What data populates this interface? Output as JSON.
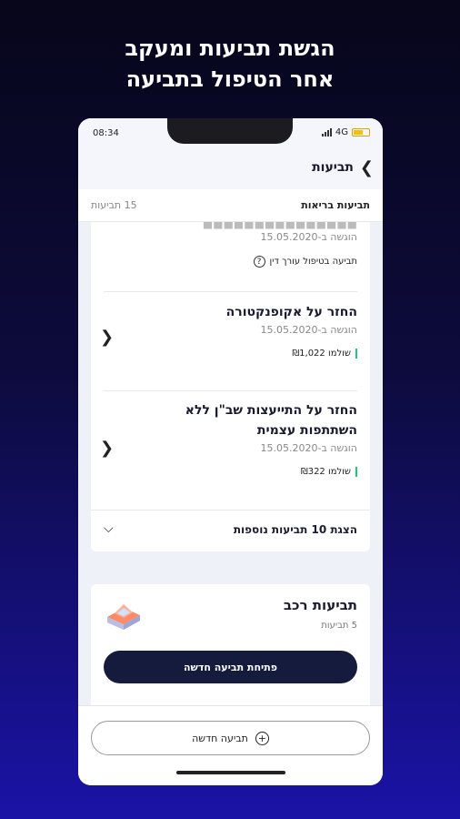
{
  "headline": {
    "line1": "הגשת תביעות ומעקב",
    "line2": "אחר הטיפול בתביעה"
  },
  "status_bar": {
    "time": "08:34",
    "network": "4G"
  },
  "app_bar": {
    "title": "תביעות"
  },
  "section": {
    "title": "תביעות בריאות",
    "count": "15 תביעות"
  },
  "claims": [
    {
      "date": "הוגשה ב-15.05.2020",
      "status": "תביעה בטיפול עורך דין"
    },
    {
      "title": "החזר על אקופנקטורה",
      "date": "הוגשה ב-15.05.2020",
      "paid": "שולמו ₪1,022"
    },
    {
      "title_line1": "החזר על התייעצות שב\"ן ללא",
      "title_line2": "השתתפות עצמית",
      "date": "הוגשה ב-15.05.2020",
      "paid": "שולמו ₪322"
    }
  ],
  "show_more": "הצגת 10 תביעות נוספות",
  "vehicle": {
    "title": "תביעות רכב",
    "count": "5 תביעות",
    "open_button": "פתיחת תביעה חדשה"
  },
  "new_claim_button": "תביעה חדשה",
  "colors": {
    "primary": "#141b3d",
    "paid": "#1ec77b",
    "car": "#ff8a6a"
  }
}
